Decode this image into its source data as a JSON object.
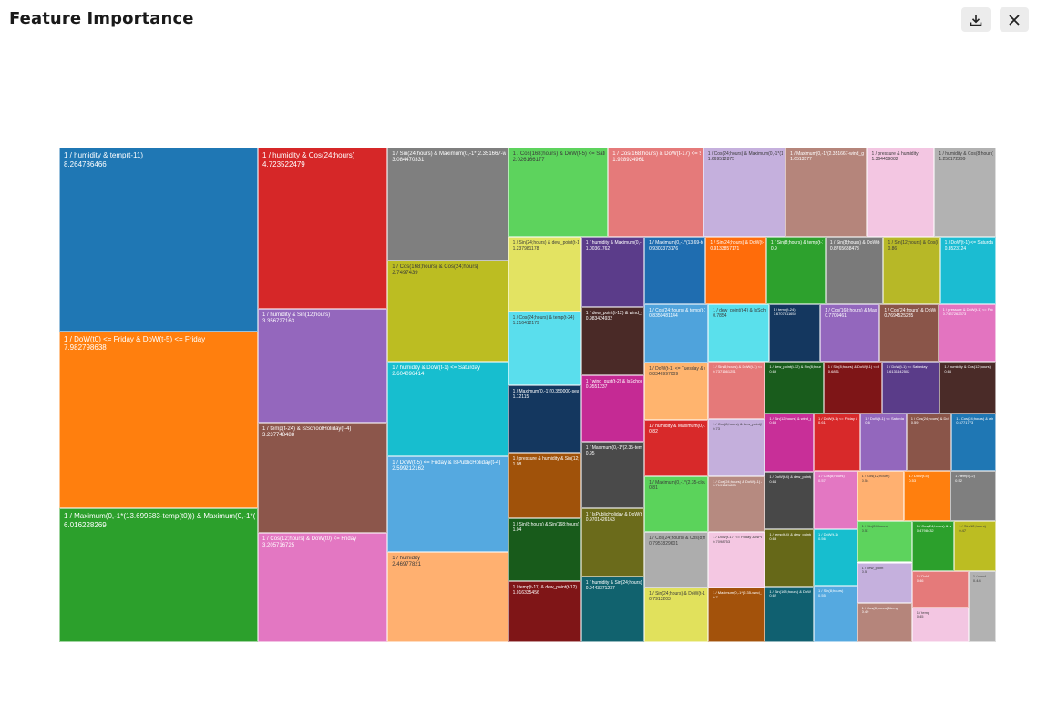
{
  "header": {
    "title": "Feature Importance"
  },
  "icons": {
    "download": "download-icon",
    "close": "close-icon"
  },
  "chart_data": {
    "type": "treemap",
    "title": "",
    "items": [
      {
        "label": "1 / humidity & temp(t-11)",
        "value": 8.264786466,
        "value_text": "8.264786466",
        "color": "#1f77b4"
      },
      {
        "label": "1 / DoW(t0) <= Friday & DoW(t-5) <= Friday",
        "value": 7.982798638,
        "value_text": "7.982798638",
        "color": "#ff7f0e"
      },
      {
        "label": "1 / Maximum(0,-1*(13.699583-temp(t0))) & Maximum(0,-1*(2.351667-wind_gust(t0)))",
        "value": 6.016228269,
        "value_text": "6.016228269",
        "color": "#2ca02c"
      },
      {
        "label": "1 / humidity & Cos(24;hours)",
        "value": 4.723522479,
        "value_text": "4.723522479",
        "color": "#d62728"
      },
      {
        "label": "1 / humidity & Sin(12;hours)",
        "value": 3.356727163,
        "value_text": "3.356727163",
        "color": "#9467bd"
      },
      {
        "label": "1 / temp(t-24) & IsSchoolHoliday(t-4)",
        "value": 3.237748488,
        "value_text": "3.237748488",
        "color": "#8c564b"
      },
      {
        "label": "1 / Cos(12;hours) & DoW(t0) <= Friday",
        "value": 3.205716725,
        "value_text": "3.205716725",
        "color": "#e377c2"
      },
      {
        "label": "1 / Sin(24;hours) & Maximum(0,-1*(2.351667-wind_gust(t0)))",
        "value": 3.084,
        "value_text": "3.084470331",
        "color": "#7f7f7f"
      },
      {
        "label": "1 / Cos(168;hours) & Cos(24;hours)",
        "value": 2.7497439,
        "value_text": "2.7497439",
        "color": "#bcbd22"
      },
      {
        "label": "1 / humidity & DoW(t-1) <= Saturday",
        "value": 2.604096414,
        "value_text": "2.604096414",
        "color": "#17becf"
      },
      {
        "label": "1 / DoW(t-5) <= Friday & IsPublicHoliday(t-4)",
        "value": 2.599212162,
        "value_text": "2.599212162",
        "color": "#55a9e0"
      },
      {
        "label": "1 / humidity",
        "value": 2.46977821,
        "value_text": "2.46977821",
        "color": "#ffb070"
      },
      {
        "label": "1 / Cos(168;hours) & DoW(t-5) <= Saturday",
        "value": 2.026166177,
        "value_text": "2.026166177",
        "color": "#5dd35d"
      },
      {
        "label": "1 / Cos(168;hours) & DoW(t-17) <= Saturday",
        "value": 1.93,
        "value_text": "1.928924961",
        "color": "#e57a7a"
      },
      {
        "label": "1 / Cos(24;hours) & Maximum(0,-1*(13.699583-temp(t0)))",
        "value": 1.67,
        "value_text": "1.669512875",
        "color": "#c5b0dd"
      },
      {
        "label": "1 / Maximum(0,-1*(2.351667-wind_gust(t0)))",
        "value": 1.65,
        "value_text": "1.6513577",
        "color": "#b5857b"
      },
      {
        "label": "1 / pressure & humidity",
        "value": 1.364459082,
        "value_text": "1.364459082",
        "color": "#f3c6e2"
      },
      {
        "label": "1 / humidity & Cos(8;hours)",
        "value": 1.250172299,
        "value_text": "1.250172299",
        "color": "#b2b2b2"
      },
      {
        "label": "1 / Sin(24;hours) & dew_point(t-12)",
        "value": 1.237981178,
        "value_text": "1.237981178",
        "color": "#e3e362"
      },
      {
        "label": "1 / Cos(24;hours) & temp(t-24)",
        "value": 1.216412179,
        "value_text": "1.216412179",
        "color": "#5adeed"
      },
      {
        "label": "1 / Maximum(0,-1*(0.350000-sea_level_pressure(t0)))",
        "value": 1.12,
        "value_text": "1.12115",
        "color": "#14375f"
      },
      {
        "label": "1 / pressure & humidity & Sin(12;hours)",
        "value": 1.08,
        "value_text": "1.08",
        "color": "#a0520a"
      },
      {
        "label": "1 / Sin(8;hours) & Sin(168;hours)",
        "value": 1.04,
        "value_text": "1.04",
        "color": "#185b1b"
      },
      {
        "label": "1 / temp(t-11) & dew_point(t-12)",
        "value": 1.016335456,
        "value_text": "1.016335456",
        "color": "#7f1517"
      },
      {
        "label": "1 / humidity & Maximum(0,-1*(0.35-clouds(t0)))",
        "value": 1.0,
        "value_text": "1.00361762",
        "color": "#5b3c8a"
      },
      {
        "label": "1 / dew_point(t-12) & wind_gust(t-10)",
        "value": 0.98,
        "value_text": "0.983424932",
        "color": "#4a2a27"
      },
      {
        "label": "1 / wind_gust(t-2) & IsSchoolHoliday(t-4)",
        "value": 0.955,
        "value_text": "0.9551237",
        "color": "#c52a94"
      },
      {
        "label": "1 / Maximum(0,-1*(2.35-temp(t0))) & IsSchoolHoliday(t-4)",
        "value": 0.95,
        "value_text": "0.95",
        "color": "#4a4a4a"
      },
      {
        "label": "1 / IsPublicHoliday & DoW(t0) <= Friday",
        "value": 0.97,
        "value_text": "0.9701426163",
        "color": "#6b6b1b"
      },
      {
        "label": "1 / humidity & Sin(24;hours)",
        "value": 0.9443371237,
        "value_text": "0.9443371237",
        "color": "#11626e"
      },
      {
        "label": "1 / Maximum(0,-1*(13.69-temp(t0)))",
        "value": 0.93,
        "value_text": "0.9303373176",
        "color": "#1f6db0"
      },
      {
        "label": "1 / Sin(24;hours) & DoW(t-1) <= Friday",
        "value": 0.92,
        "value_text": "0.9133857171",
        "color": "#ff6c0a"
      },
      {
        "label": "1 / Sin(8;hours) & temp(t-11)",
        "value": 0.9,
        "value_text": "0.9",
        "color": "#2da12d"
      },
      {
        "label": "1 / Sin(8;hours) & DoW(t-1) <= Saturday",
        "value": 0.88,
        "value_text": "0.8765638473",
        "color": "#7a7a7a"
      },
      {
        "label": "1 / Sin(12;hours) & Cos(8;hours)",
        "value": 0.86,
        "value_text": "0.86",
        "color": "#b7b827"
      },
      {
        "label": "1 / DoW(t-1) <= Saturday & dew_point(t-12)",
        "value": 0.85,
        "value_text": "0.8523124",
        "color": "#1bbcd2"
      },
      {
        "label": "1 / Cos(24;hours) & temp(t-11)",
        "value": 0.84,
        "value_text": "0.8350481144",
        "color": "#4fa3dc"
      },
      {
        "label": "1 / DoW(t-1) <= Tuesday & wind_gust(t-4)",
        "value": 0.83,
        "value_text": "0.8346997009",
        "color": "#ffb46e"
      },
      {
        "label": "1 / humidity & Maximum(0,-1*(0.35-clouds(t0)))",
        "value": 0.82,
        "value_text": "0.82",
        "color": "#d8292a"
      },
      {
        "label": "1 / Maximum(0,-1*(2.35-clouds(t0))) & temp(t-11)",
        "value": 0.81,
        "value_text": "0.81",
        "color": "#5bd35b"
      },
      {
        "label": "1 / Cos(24;hours) & Cos(8;hours)",
        "value": 0.8,
        "value_text": "0.7951829601",
        "color": "#adadad"
      },
      {
        "label": "1 / Sin(24;hours) & DoW(t-1) <= Monday",
        "value": 0.79,
        "value_text": "0.7913203",
        "color": "#e1e15c"
      },
      {
        "label": "1 / dew_point(t-4) & IsSchoolHoliday",
        "value": 0.785,
        "value_text": "0.7854",
        "color": "#5ae0ec"
      },
      {
        "label": "1 / temp(t-24)",
        "value": 0.6707811654,
        "value_text": "0.6707811654",
        "color": "#14375f"
      },
      {
        "label": "1 / Cos(168;hours) & Maximum(0,-1*(0.35-clouds(t0)))",
        "value": 0.77,
        "value_text": "0.7709461",
        "color": "#9367bd"
      },
      {
        "label": "1 / Cos(24;hours) & DoW(t0) <= Friday",
        "value": 0.76,
        "value_text": "0.7694525285",
        "color": "#8a5549"
      },
      {
        "label": "1 / pressure & DoW(t-1) <= Friday",
        "value": 0.75,
        "value_text": "0.7437262373",
        "color": "#e374c0"
      },
      {
        "label": "1 / Sin(8;hours) & DoW(t-1) <= Friday & temp(t-12)",
        "value": 0.74,
        "value_text": "0.7371661251",
        "color": "#e57979"
      },
      {
        "label": "1 / Cos(8;hours) & dew_point(t-12)",
        "value": 0.73,
        "value_text": "0.73",
        "color": "#c4afdc"
      },
      {
        "label": "1 / Cos(24;hours) & DoW(t-1) & IsPublicHoliday",
        "value": 0.72,
        "value_text": "0.7191621853",
        "color": "#b68a80"
      },
      {
        "label": "1 / DoW(t-17) <= Friday & IsPublicHoliday(t-6)",
        "value": 0.71,
        "value_text": "0.7098753",
        "color": "#f4c7e2"
      },
      {
        "label": "1 / Maximum(0,-1*(2.35-wind_gust(t0)))",
        "value": 0.7,
        "value_text": "0.7",
        "color": "#a3520b"
      },
      {
        "label": "1 / dew_point(t-12) & Sin(8;hours)",
        "value": 0.69,
        "value_text": "0.69",
        "color": "#195c1c"
      },
      {
        "label": "1 / Sin(8;hours) & DoW(t-1) <= Friday",
        "value": 0.685,
        "value_text": "0.6851",
        "color": "#7e1517"
      },
      {
        "label": "1 / DoW(t-1) <= Saturday",
        "value": 0.68,
        "value_text": "0.6131442502",
        "color": "#5a3c89"
      },
      {
        "label": "1 / humidity & Cos(12;hours)",
        "value": 0.66,
        "value_text": "0.66",
        "color": "#4a2b28"
      },
      {
        "label": "1 / Sin(12;hours) & wind_gust(t-4)",
        "value": 0.65,
        "value_text": "0.65",
        "color": "#c82f98"
      },
      {
        "label": "1 / DoW(t-4) & dew_point(t-4)",
        "value": 0.64,
        "value_text": "0.64",
        "color": "#484848"
      },
      {
        "label": "1 / temp(t-4) & dew_point(t-12)",
        "value": 0.63,
        "value_text": "0.63",
        "color": "#666818"
      },
      {
        "label": "1 / Sin(168;hours) & DoW(t-1)",
        "value": 0.62,
        "value_text": "0.62",
        "color": "#106070"
      },
      {
        "label": "1 / DoW(t-1) <= Friday & temp",
        "value": 0.61,
        "value_text": "0.61",
        "color": "#d8292a"
      },
      {
        "label": "1 / DoW(t-1) <= Saturday & Sin",
        "value": 0.6,
        "value_text": "0.6",
        "color": "#9367bd"
      },
      {
        "label": "1 / Cos(24;hours) & DoW(t-5)",
        "value": 0.59,
        "value_text": "0.59",
        "color": "#8a5549"
      },
      {
        "label": "1 / Cos(24;hours) & wind_gust(t-12)",
        "value": 0.58,
        "value_text": "0.5771773",
        "color": "#1f77b4"
      },
      {
        "label": "1 / Cos(8;hours)",
        "value": 0.57,
        "value_text": "0.57",
        "color": "#e377c2"
      },
      {
        "label": "1 / DoW(t-1)",
        "value": 0.56,
        "value_text": "0.56",
        "color": "#17becf"
      },
      {
        "label": "1 / Sin(8;hours)",
        "value": 0.55,
        "value_text": "0.55",
        "color": "#55a9e0"
      },
      {
        "label": "1 / Cos(12;hours)",
        "value": 0.54,
        "value_text": "0.54",
        "color": "#ffb070"
      },
      {
        "label": "1 / DoW(t-5)",
        "value": 0.53,
        "value_text": "0.53",
        "color": "#ff7f0e"
      },
      {
        "label": "1 / temp(t-2)",
        "value": 0.52,
        "value_text": "0.52",
        "color": "#7f7f7f"
      },
      {
        "label": "1 / Sin(24;hours)",
        "value": 0.51,
        "value_text": "0.51",
        "color": "#5dd35d"
      },
      {
        "label": "1 / dew_point",
        "value": 0.5,
        "value_text": "0.5",
        "color": "#c5b0dd"
      },
      {
        "label": "1 / Cos(8;hours)&temp",
        "value": 0.49,
        "value_text": "0.49",
        "color": "#b5857b"
      },
      {
        "label": "1 / Cos(24;hours) & wind_gust(t-4)",
        "value": 0.48,
        "value_text": "0.4798432",
        "color": "#2ca02c"
      },
      {
        "label": "1 / Sin(12;hours)",
        "value": 0.47,
        "value_text": "0.47",
        "color": "#bcbd22"
      },
      {
        "label": "1 / DoW",
        "value": 0.46,
        "value_text": "0.46",
        "color": "#e57a7a"
      },
      {
        "label": "1 / temp",
        "value": 0.45,
        "value_text": "0.45",
        "color": "#f3c6e2"
      },
      {
        "label": "1 / wind",
        "value": 0.44,
        "value_text": "0.44",
        "color": "#b2b2b2"
      }
    ]
  }
}
